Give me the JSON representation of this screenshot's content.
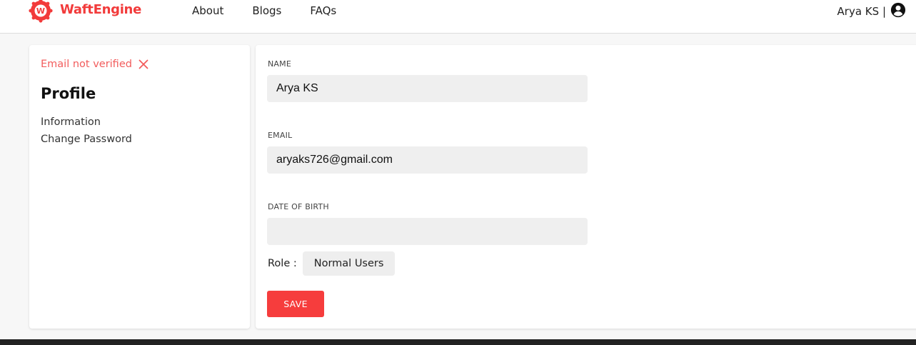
{
  "brand": {
    "name": "WaftEngine",
    "logo_letter": "W",
    "color": "#f23b3b"
  },
  "nav": {
    "items": [
      "About",
      "Blogs",
      "FAQs"
    ]
  },
  "user": {
    "name_label": "Arya KS |",
    "icon": "account-circle-icon"
  },
  "sidebar": {
    "verify_status": "Email not verified",
    "verify_icon": "close-icon",
    "title": "Profile",
    "links": [
      "Information",
      "Change Password"
    ]
  },
  "form": {
    "name": {
      "label": "NAME",
      "value": "Arya KS"
    },
    "email": {
      "label": "EMAIL",
      "value": "aryaks726@gmail.com"
    },
    "dob": {
      "label": "DATE OF BIRTH",
      "value": ""
    },
    "role": {
      "label": "Role :",
      "value": "Normal Users"
    },
    "save_label": "SAVE"
  },
  "colors": {
    "accent": "#f63d3d",
    "warning_text": "#f25c5c",
    "input_bg": "#efefef"
  }
}
